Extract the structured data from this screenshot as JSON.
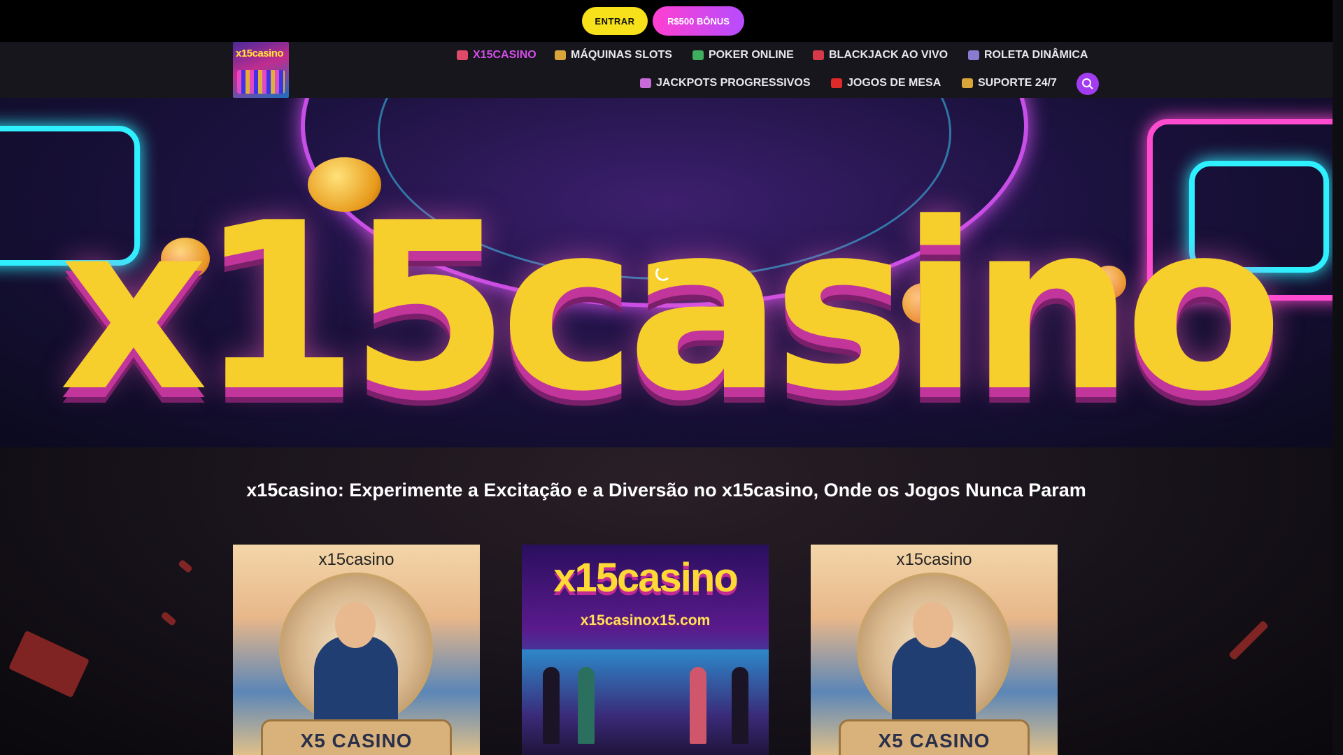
{
  "topbar": {
    "login_label": "ENTRAR",
    "bonus_label": "R$500 BÔNUS"
  },
  "logo": {
    "text": "x15casino"
  },
  "nav": {
    "items": [
      {
        "label": "X15CASINO",
        "icon": "slot-machine-icon",
        "icon_color": "#e04a6a",
        "active": true
      },
      {
        "label": "MÁQUINAS SLOTS",
        "icon": "cards-icon",
        "icon_color": "#d9a43a",
        "active": false
      },
      {
        "label": "POKER ONLINE",
        "icon": "store-icon",
        "icon_color": "#3fae5e",
        "active": false
      },
      {
        "label": "BLACKJACK AO VIVO",
        "icon": "dice-icon",
        "icon_color": "#d63a4a",
        "active": false
      },
      {
        "label": "ROLETA DINÂMICA",
        "icon": "gamepad-icon",
        "icon_color": "#8a7ad0",
        "active": false
      },
      {
        "label": "JACKPOTS PROGRESSIVOS",
        "icon": "slot-machine-icon",
        "icon_color": "#c86ad8",
        "active": false
      },
      {
        "label": "JOGOS DE MESA",
        "icon": "video-play-icon",
        "icon_color": "#e02a2a",
        "active": false
      },
      {
        "label": "SUPORTE 24/7",
        "icon": "cards-icon",
        "icon_color": "#d9a43a",
        "active": false
      }
    ],
    "search_icon": "search-icon"
  },
  "hero": {
    "banner_text": "x15casino"
  },
  "main": {
    "title": "x15casino: Experimente a Excitação e a Diversão no x15casino, Onde os Jogos Nunca Param"
  },
  "cards": [
    {
      "caption": "x15casino",
      "desk_text": "X5 CASINO"
    },
    {
      "caption": "x15casino",
      "subcaption": "x15casinox15.com"
    },
    {
      "caption": "x15casino",
      "desk_text": "X5 CASINO"
    }
  ],
  "colors": {
    "accent": "#a23cf0",
    "login_button": "#f6e11a",
    "active_nav": "#d44ee8"
  }
}
